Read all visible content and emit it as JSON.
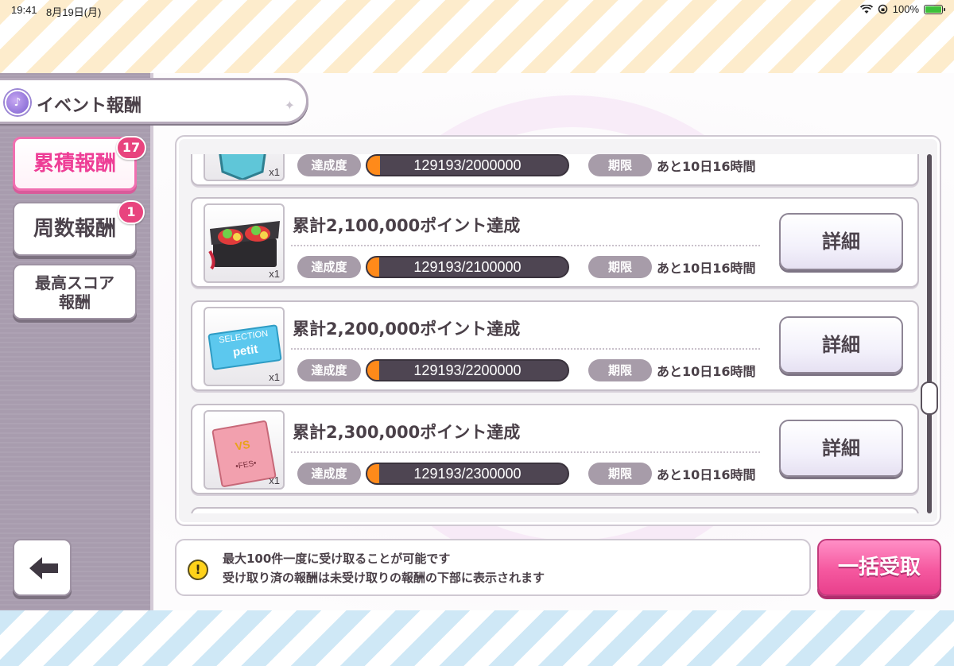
{
  "status_bar": {
    "time": "19:41",
    "date": "8月19日(月)",
    "battery": "100%",
    "icons": [
      "wifi-icon",
      "orientation-lock-icon",
      "battery-icon"
    ]
  },
  "header": {
    "title": "イベント報酬",
    "icon": "music-note-icon"
  },
  "sidebar": {
    "tabs": [
      {
        "label": "累積報酬",
        "badge": "17",
        "active": true
      },
      {
        "label": "周数報酬",
        "badge": "1",
        "active": false
      },
      {
        "label_line1": "最高スコア",
        "label_line2": "報酬",
        "active": false
      }
    ],
    "back_icon": "arrow-left-icon"
  },
  "rewards": [
    {
      "name": "",
      "quantity": "x1",
      "achievement_label": "達成度",
      "progress_text": "129193/2000000",
      "progress": 0.0646,
      "deadline_label": "期限",
      "remaining": "あと10日16時間",
      "detail_label": ""
    },
    {
      "name": "累計2,100,000ポイント達成",
      "quantity": "x1",
      "achievement_label": "達成度",
      "progress_text": "129193/2100000",
      "progress": 0.0615,
      "deadline_label": "期限",
      "remaining": "あと10日16時間",
      "detail_label": "詳細"
    },
    {
      "name": "累計2,200,000ポイント達成",
      "quantity": "x1",
      "achievement_label": "達成度",
      "progress_text": "129193/2200000",
      "progress": 0.0587,
      "deadline_label": "期限",
      "remaining": "あと10日16時間",
      "detail_label": "詳細",
      "thumb_text_1": "SELECTION",
      "thumb_text_2": "petit"
    },
    {
      "name": "累計2,300,000ポイント達成",
      "quantity": "x1",
      "achievement_label": "達成度",
      "progress_text": "129193/2300000",
      "progress": 0.0562,
      "deadline_label": "期限",
      "remaining": "あと10日16時間",
      "detail_label": "詳細",
      "thumb_text_1": "VS",
      "thumb_text_2": "•FES•"
    }
  ],
  "info": {
    "line1": "最大100件一度に受け取ることが可能です",
    "line2": "受け取り済の報酬は未受け取りの報酬の下部に表示されます",
    "icon_text": "!"
  },
  "bulk_receive_label": "一括受取",
  "colors": {
    "accent_pink": "#f06fb0",
    "progress_orange": "#ff8a1a",
    "sidebar_bg": "#a89cae"
  }
}
